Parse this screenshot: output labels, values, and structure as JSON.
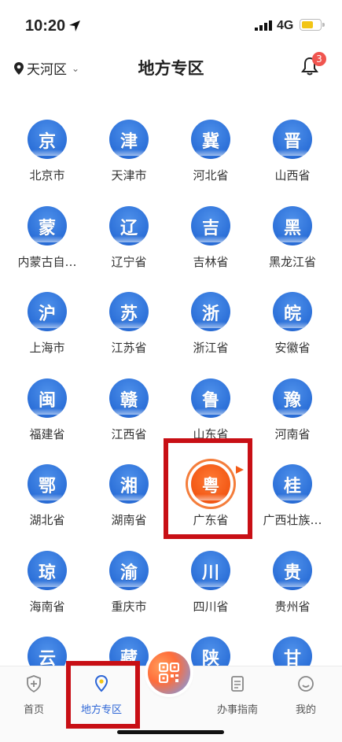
{
  "status_bar": {
    "time": "10:20",
    "network": "4G"
  },
  "header": {
    "district": "天河区",
    "title": "地方专区",
    "notification_count": "3"
  },
  "regions": [
    {
      "glyph": "京",
      "label": "北京市"
    },
    {
      "glyph": "津",
      "label": "天津市"
    },
    {
      "glyph": "冀",
      "label": "河北省"
    },
    {
      "glyph": "晋",
      "label": "山西省"
    },
    {
      "glyph": "蒙",
      "label": "内蒙古自…"
    },
    {
      "glyph": "辽",
      "label": "辽宁省"
    },
    {
      "glyph": "吉",
      "label": "吉林省"
    },
    {
      "glyph": "黑",
      "label": "黑龙江省"
    },
    {
      "glyph": "沪",
      "label": "上海市"
    },
    {
      "glyph": "苏",
      "label": "江苏省"
    },
    {
      "glyph": "浙",
      "label": "浙江省"
    },
    {
      "glyph": "皖",
      "label": "安徽省"
    },
    {
      "glyph": "闽",
      "label": "福建省"
    },
    {
      "glyph": "赣",
      "label": "江西省"
    },
    {
      "glyph": "鲁",
      "label": "山东省"
    },
    {
      "glyph": "豫",
      "label": "河南省"
    },
    {
      "glyph": "鄂",
      "label": "湖北省"
    },
    {
      "glyph": "湘",
      "label": "湖南省"
    },
    {
      "glyph": "粤",
      "label": "广东省",
      "highlight": true
    },
    {
      "glyph": "桂",
      "label": "广西壮族…"
    },
    {
      "glyph": "琼",
      "label": "海南省"
    },
    {
      "glyph": "渝",
      "label": "重庆市"
    },
    {
      "glyph": "川",
      "label": "四川省"
    },
    {
      "glyph": "贵",
      "label": "贵州省"
    },
    {
      "glyph": "云",
      "label": ""
    },
    {
      "glyph": "藏",
      "label": ""
    },
    {
      "glyph": "陕",
      "label": ""
    },
    {
      "glyph": "甘",
      "label": ""
    }
  ],
  "tabbar": {
    "home": "首页",
    "local": "地方专区",
    "guide": "办事指南",
    "mine": "我的"
  },
  "colors": {
    "accent": "#2d66d6",
    "highlight_box": "#c80f15",
    "guangdong_orange": "#f25714"
  }
}
